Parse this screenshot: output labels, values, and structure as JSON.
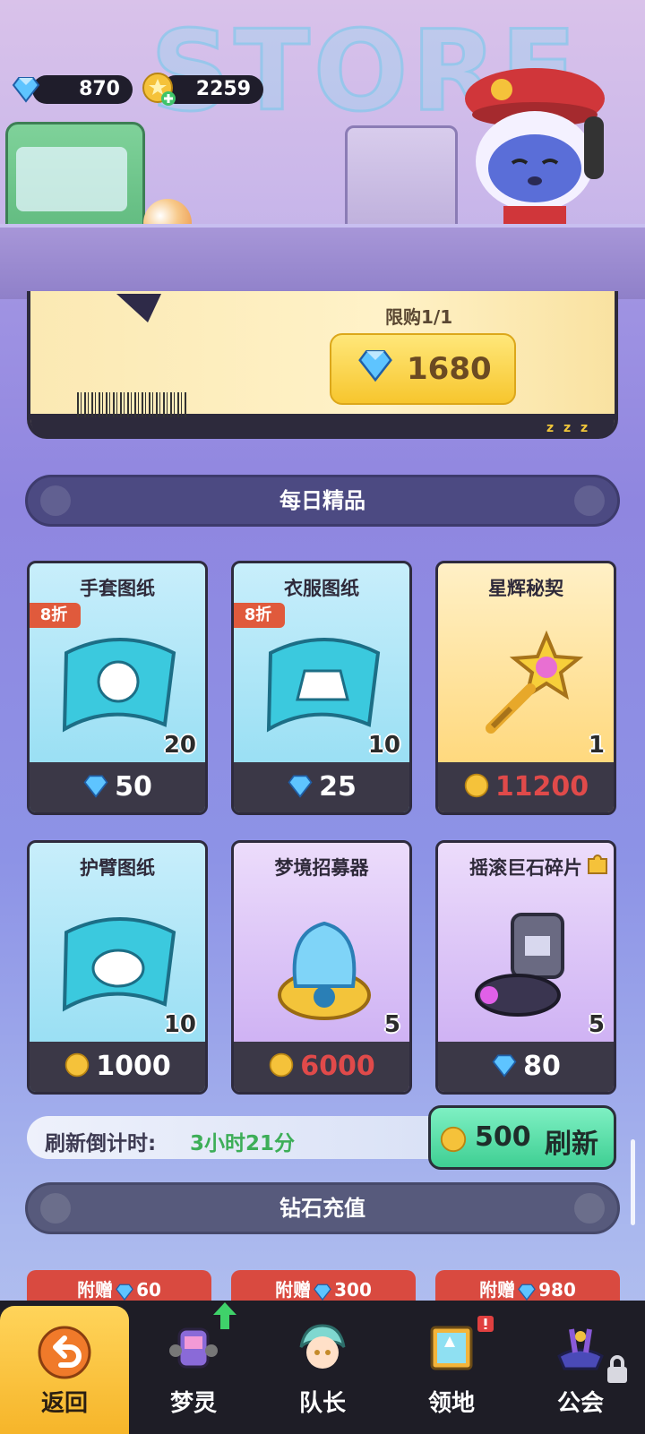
{
  "currencies": {
    "diamonds": "870",
    "coins": "2259"
  },
  "header": {
    "title": "STORE"
  },
  "featured": {
    "limit_text": "限购1/1",
    "price": "1680",
    "stamp": "z z z"
  },
  "daily_section": {
    "title": "每日精品"
  },
  "items": [
    {
      "name": "手套图纸",
      "discount": "8折",
      "qty": "20",
      "price": "50",
      "currency": "diamond",
      "icon": "glove-blueprint-icon"
    },
    {
      "name": "衣服图纸",
      "discount": "8折",
      "qty": "10",
      "price": "25",
      "currency": "diamond",
      "icon": "clothes-blueprint-icon"
    },
    {
      "name": "星辉秘契",
      "discount": "",
      "qty": "1",
      "price": "11200",
      "currency": "coin",
      "icon": "star-key-icon"
    },
    {
      "name": "护臂图纸",
      "discount": "",
      "qty": "10",
      "price": "1000",
      "currency": "coin",
      "icon": "armguard-blueprint-icon"
    },
    {
      "name": "梦境招募器",
      "discount": "",
      "qty": "5",
      "price": "6000",
      "currency": "coin",
      "icon": "dream-recruiter-icon"
    },
    {
      "name": "摇滚巨石碎片",
      "discount": "",
      "qty": "5",
      "price": "80",
      "currency": "diamond",
      "icon": "rock-boulder-shard-icon"
    }
  ],
  "refresh": {
    "label": "刷新倒计时:",
    "time": "3小时21分",
    "cost": "500",
    "button_label": "刷新"
  },
  "recharge_section": {
    "title": "钻石充值",
    "bonuses": [
      {
        "label": "附赠",
        "amount": "60"
      },
      {
        "label": "附赠",
        "amount": "300"
      },
      {
        "label": "附赠",
        "amount": "980"
      }
    ]
  },
  "nav": [
    {
      "label": "返回",
      "icon": "back-arrow-icon"
    },
    {
      "label": "梦灵",
      "icon": "dream-spirit-icon"
    },
    {
      "label": "队长",
      "icon": "captain-icon"
    },
    {
      "label": "领地",
      "icon": "territory-icon"
    },
    {
      "label": "公会",
      "icon": "guild-icon"
    }
  ],
  "colors": {
    "accent_gold": "#f7c62e",
    "discount_red": "#e05a3c",
    "refresh_green": "#3fcf93",
    "nav_bg": "#1e1d26",
    "price_red": "#e04a4a"
  }
}
